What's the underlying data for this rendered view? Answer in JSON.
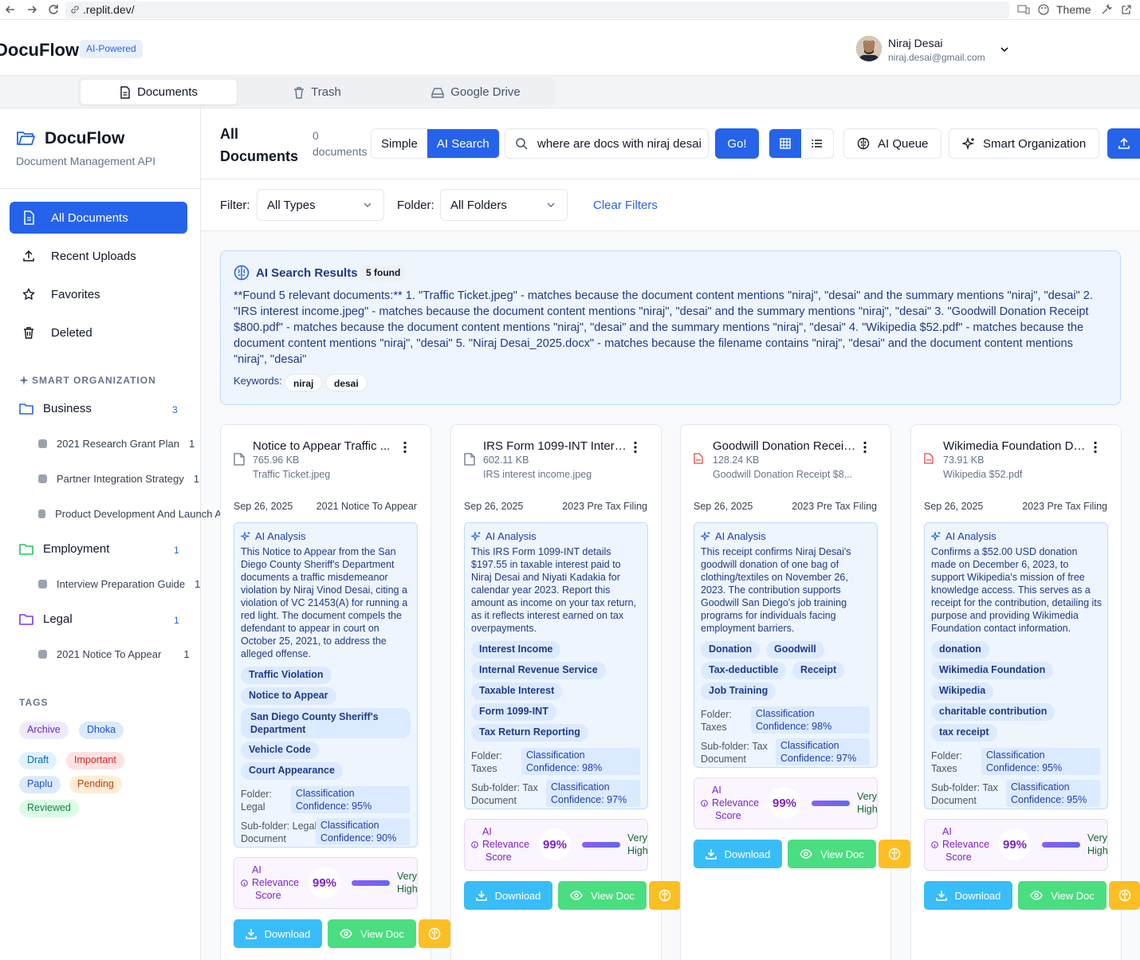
{
  "browser": {
    "url": ".replit.dev/",
    "theme_label": "Theme"
  },
  "header": {
    "brand": "DocuFlow",
    "badge": "AI-Powered",
    "user_name": "Niraj Desai",
    "user_email": "niraj.desai@gmail.com"
  },
  "tabs": [
    {
      "label": "Documents"
    },
    {
      "label": "Trash"
    },
    {
      "label": "Google Drive"
    }
  ],
  "sidebar": {
    "title": "DocuFlow",
    "subtitle": "Document Management API",
    "nav": [
      {
        "label": "All Documents"
      },
      {
        "label": "Recent Uploads"
      },
      {
        "label": "Favorites"
      },
      {
        "label": "Deleted"
      }
    ],
    "smart_heading": "SMART ORGANIZATION",
    "folders": [
      {
        "name": "Business",
        "count": "3",
        "subs": [
          {
            "name": "2021 Research Grant Plan",
            "count": "1"
          },
          {
            "name": "Partner Integration Strategy",
            "count": "1"
          },
          {
            "name": "Product Development And Launch A",
            "count": ""
          }
        ]
      },
      {
        "name": "Employment",
        "count": "1",
        "subs": [
          {
            "name": "Interview Preparation Guide",
            "count": "1"
          }
        ]
      },
      {
        "name": "Legal",
        "count": "1",
        "subs": [
          {
            "name": "2021 Notice To Appear",
            "count": "1"
          }
        ]
      }
    ],
    "tags_heading": "TAGS",
    "tags": [
      "Archive",
      "Dhoka",
      "Draft",
      "Important",
      "Paplu",
      "Pending",
      "Reviewed"
    ]
  },
  "toolbar": {
    "title_line1": "All",
    "title_line2": "Documents",
    "count_line1": "0",
    "count_line2": "documents",
    "mode_simple": "Simple",
    "mode_ai": "AI Search",
    "search_value": "where are docs with niraj desai",
    "go": "Go!",
    "ai_queue": "AI Queue",
    "smart_org": "Smart Organization"
  },
  "filters": {
    "filter_label": "Filter:",
    "filter_value": "All Types",
    "folder_label": "Folder:",
    "folder_value": "All Folders",
    "clear": "Clear Filters"
  },
  "ai_results": {
    "title": "AI Search Results",
    "found": "5 found",
    "text": "**Found 5 relevant documents:** 1. \"Traffic Ticket.jpeg\" - matches because the document content mentions \"niraj\", \"desai\" and the summary mentions \"niraj\", \"desai\" 2. \"IRS interest income.jpeg\" - matches because the document content mentions \"niraj\", \"desai\" and the summary mentions \"niraj\", \"desai\" 3. \"Goodwill Donation Receipt $800.pdf\" - matches because the document content mentions \"niraj\", \"desai\" and the summary mentions \"niraj\", \"desai\" 4. \"Wikipedia $52.pdf\" - matches because the document content mentions \"niraj\", \"desai\" 5. \"Niraj Desai_2025.docx\" - matches because the filename contains \"niraj\", \"desai\" and the document content mentions \"niraj\", \"desai\"",
    "keywords_label": "Keywords:",
    "keywords": [
      "niraj",
      "desai"
    ]
  },
  "card_labels": {
    "ai_analysis": "AI Analysis",
    "folder": "Folder:",
    "subfolder": "Sub-folder:",
    "relevance_1": "AI",
    "relevance_2": "Relevance",
    "relevance_3": "Score",
    "very": "Very",
    "high": "High",
    "download": "Download",
    "view": "View Doc"
  },
  "cards": [
    {
      "title": "Notice to Appear Traffic ...",
      "size": "765.96 KB",
      "file": "Traffic Ticket.jpeg",
      "date": "Sep 26, 2025",
      "category": "2021 Notice To Appear",
      "icon": "image-file-icon",
      "summary": "This Notice to Appear from the San Diego County Sheriff's Department documents a traffic misdemeanor violation by Niraj Vinod Desai, citing a violation of VC 21453(A) for running a red light. The document compels the defendant to appear in court on October 25, 2021, to address the alleged offense.",
      "tags": [
        "Traffic Violation",
        "Notice to Appear",
        "San Diego County Sheriff's Department",
        "Vehicle Code",
        "Court Appearance"
      ],
      "folder": "Legal",
      "folder_conf": "Classification Confidence: 95%",
      "subfolder": "Legal Document",
      "subfolder_conf": "Classification Confidence: 90%",
      "score": "99%"
    },
    {
      "title": "IRS Form 1099-INT Intere...",
      "size": "602.11 KB",
      "file": "IRS interest income.jpeg",
      "date": "Sep 26, 2025",
      "category": "2023 Pre Tax Filing",
      "icon": "image-file-icon",
      "summary": "This IRS Form 1099-INT details $197.55 in taxable interest paid to Niraj Desai and Niyati Kadakia for calendar year 2023. Report this amount as income on your tax return, as it reflects interest earned on tax overpayments.",
      "tags": [
        "Interest Income",
        "Internal Revenue Service",
        "Taxable Interest",
        "Form 1099-INT",
        "Tax Return Reporting"
      ],
      "folder": "Taxes",
      "folder_conf": "Classification Confidence: 98%",
      "subfolder": "Tax Document",
      "subfolder_conf": "Classification Confidence: 97%",
      "score": "99%"
    },
    {
      "title": "Goodwill Donation Receip...",
      "size": "128.24 KB",
      "file": "Goodwill Donation Receipt $8...",
      "date": "Sep 26, 2025",
      "category": "2023 Pre Tax Filing",
      "icon": "pdf-file-icon",
      "summary": "This receipt confirms Niraj Desai's goodwill donation of one bag of clothing/textiles on November 26, 2023. The contribution supports Goodwill San Diego's job training programs for individuals facing employment barriers.",
      "tags": [
        "Donation",
        "Goodwill",
        "Tax-deductible",
        "Receipt",
        "Job Training"
      ],
      "folder": "Taxes",
      "folder_conf": "Classification Confidence: 98%",
      "subfolder": "Tax Document",
      "subfolder_conf": "Classification Confidence: 97%",
      "score": "99%"
    },
    {
      "title": "Wikimedia Foundation Do...",
      "size": "73.91 KB",
      "file": "Wikipedia $52.pdf",
      "date": "Sep 26, 2025",
      "category": "2023 Pre Tax Filing",
      "icon": "pdf-file-icon",
      "summary": "Confirms a $52.00 USD donation made on December 6, 2023, to support Wikipedia's mission of free knowledge access. This serves as a receipt for the contribution, detailing its purpose and providing Wikimedia Foundation contact information.",
      "tags": [
        "donation",
        "Wikimedia Foundation",
        "Wikipedia",
        "charitable contribution",
        "tax receipt"
      ],
      "folder": "Taxes",
      "folder_conf": "Classification Confidence: 95%",
      "subfolder": "Tax Document",
      "subfolder_conf": "Classification Confidence: 95%",
      "score": "99%"
    }
  ],
  "colors": {
    "primary": "#2563eb",
    "download": "#38bdf8",
    "view": "#4ade80",
    "analyze": "#fbbf24"
  }
}
